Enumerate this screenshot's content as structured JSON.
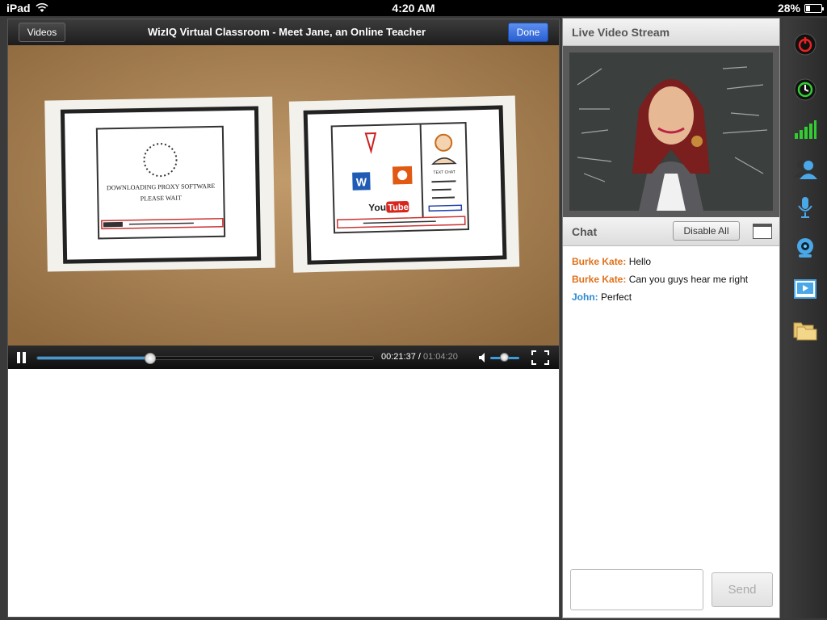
{
  "status_bar": {
    "device": "iPad",
    "time": "4:20 AM",
    "battery": "28%",
    "battery_level": 0.28
  },
  "video_player": {
    "videos_button": "Videos",
    "title": "WizIQ Virtual Classroom - Meet Jane, an Online Teacher",
    "done_button": "Done",
    "current_time": "00:21:37",
    "separator": "/",
    "total_time": "01:04:20",
    "progress": 0.336,
    "volume": 0.6,
    "frame": {
      "left_card_line1": "DOWNLOADING PROXY SOFTWARE",
      "left_card_line2": "PLEASE WAIT",
      "right_card_chat": "TEXT CHAT",
      "youtube_text": "You",
      "youtube_tube": "Tube"
    }
  },
  "live_stream": {
    "header": "Live Video Stream"
  },
  "chat": {
    "header": "Chat",
    "disable_all": "Disable All",
    "messages": [
      {
        "who": "Burke Kate:",
        "text": "Hello",
        "color": "#e0701a"
      },
      {
        "who": "Burke Kate:",
        "text": "Can you guys hear me right",
        "color": "#e0701a"
      },
      {
        "who": "John:",
        "text": "Perfect",
        "color": "#2a8ad0"
      }
    ],
    "send_button": "Send"
  },
  "toolbar": {
    "items": [
      "power-icon",
      "timer-icon",
      "signal-icon",
      "users-icon",
      "microphone-icon",
      "webcam-icon",
      "media-player-icon",
      "folder-icon"
    ]
  },
  "colors": {
    "accent_blue": "#3a9be0",
    "done_blue": "#2a5ed0",
    "chat_orange": "#e0701a",
    "chat_blue": "#2a8ad0"
  }
}
